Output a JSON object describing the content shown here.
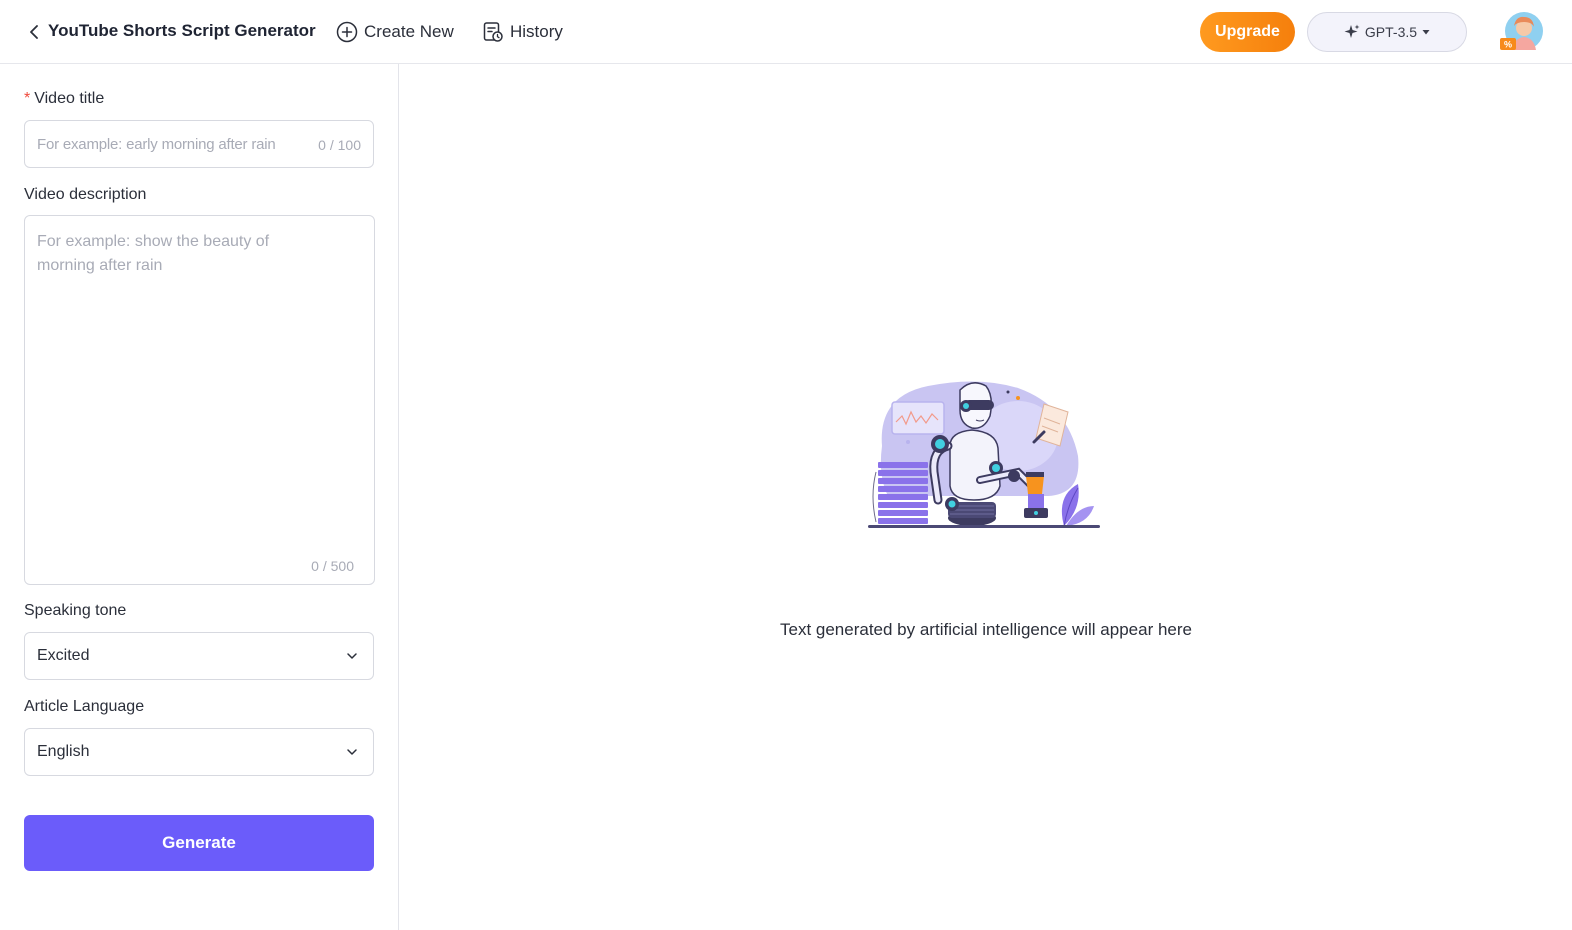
{
  "header": {
    "title": "YouTube Shorts Script Generator",
    "create_new_label": "Create New",
    "history_label": "History",
    "upgrade_label": "Upgrade",
    "model_label": "GPT-3.5"
  },
  "form": {
    "title_field": {
      "label": "Video title",
      "required": true,
      "placeholder": "For example: early morning after rain",
      "value": "",
      "counter": "0 / 100"
    },
    "description_field": {
      "label": "Video description",
      "placeholder": "For example: show the beauty of morning after rain",
      "value": "",
      "counter": "0 / 500"
    },
    "tone_field": {
      "label": "Speaking tone",
      "value": "Excited"
    },
    "language_field": {
      "label": "Article Language",
      "value": "English"
    },
    "generate_label": "Generate"
  },
  "main": {
    "empty_message": "Text generated by artificial intelligence will appear here"
  },
  "colors": {
    "accent": "#6b5cfa",
    "upgrade": "#f7891a",
    "required": "#ef4a3c"
  },
  "icons": [
    "chevron-left-icon",
    "plus-circle-icon",
    "history-icon",
    "sparkle-icon",
    "caret-down-icon",
    "chevron-down-icon",
    "avatar"
  ]
}
